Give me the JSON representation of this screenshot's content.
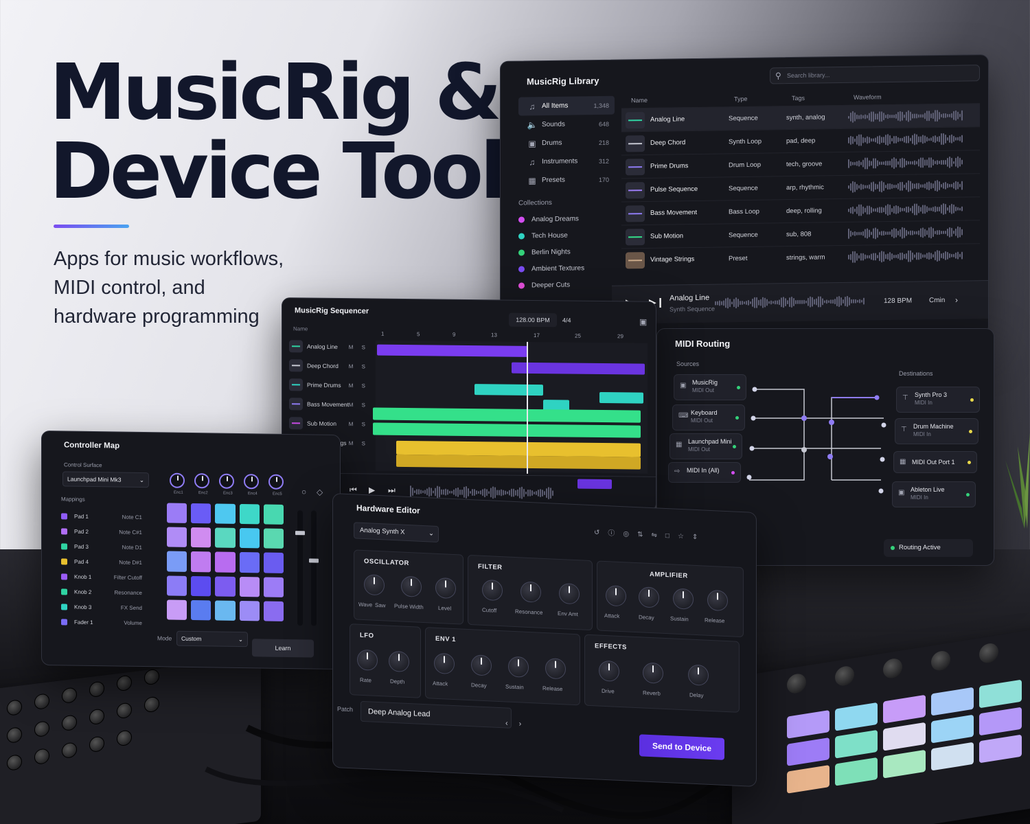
{
  "hero": {
    "title_line1": "MusicRig &",
    "title_line2": "Device Tools",
    "subtitle_line1": "Apps for music workflows,",
    "subtitle_line2": "MIDI control, and",
    "subtitle_line3": "hardware programming",
    "accent_gradient": [
      "#7a4cf0",
      "#4aa3f0"
    ]
  },
  "library": {
    "title": "MusicRig Library",
    "search_placeholder": "Search library...",
    "categories": [
      {
        "label": "All Items",
        "count": "1,348",
        "icon": "music-note-icon"
      },
      {
        "label": "Sounds",
        "count": "648",
        "icon": "speaker-icon"
      },
      {
        "label": "Drums",
        "count": "218",
        "icon": "drum-icon"
      },
      {
        "label": "Instruments",
        "count": "312",
        "icon": "music-note-icon"
      },
      {
        "label": "Presets",
        "count": "170",
        "icon": "preset-icon"
      }
    ],
    "collections_heading": "Collections",
    "collections": [
      {
        "label": "Analog Dreams",
        "color": "#d24ef0"
      },
      {
        "label": "Tech House",
        "color": "#2fd3c2"
      },
      {
        "label": "Berlin Nights",
        "color": "#34d17a"
      },
      {
        "label": "Ambient Textures",
        "color": "#7a4cf0"
      },
      {
        "label": "Deeper Cuts",
        "color": "#e04ed8"
      }
    ],
    "columns": [
      "Name",
      "Type",
      "Tags",
      "Waveform"
    ],
    "rows": [
      {
        "name": "Analog Line",
        "type": "Sequence",
        "tags": "synth, analog"
      },
      {
        "name": "Deep Chord",
        "type": "Synth Loop",
        "tags": "pad, deep"
      },
      {
        "name": "Prime Drums",
        "type": "Drum Loop",
        "tags": "tech, groove"
      },
      {
        "name": "Pulse Sequence",
        "type": "Sequence",
        "tags": "arp, rhythmic"
      },
      {
        "name": "Bass Movement",
        "type": "Bass Loop",
        "tags": "deep, rolling"
      },
      {
        "name": "Sub Motion",
        "type": "Sequence",
        "tags": "sub, 808"
      },
      {
        "name": "Vintage Strings",
        "type": "Preset",
        "tags": "strings, warm"
      }
    ],
    "player": {
      "track": "Analog Line",
      "subtitle": "Synth Sequence",
      "bpm": "128 BPM",
      "key": "Cmin"
    }
  },
  "routing": {
    "title": "MIDI Routing",
    "sources_heading": "Sources",
    "destinations_heading": "Destinations",
    "sources": [
      {
        "name": "MusicRig",
        "sub": "MIDI Out",
        "dot": "#34d17a"
      },
      {
        "name": "Keyboard",
        "sub": "MIDI Out",
        "dot": "#34d17a"
      },
      {
        "name": "Launchpad Mini",
        "sub": "MIDI Out",
        "dot": "#34d17a"
      },
      {
        "name": "MIDI In (All)",
        "sub": "",
        "dot": "#d24ef0"
      }
    ],
    "destinations": [
      {
        "name": "Synth Pro 3",
        "sub": "MIDI In",
        "dot": "#e8d84a"
      },
      {
        "name": "Drum Machine",
        "sub": "MIDI In",
        "dot": "#e8d84a"
      },
      {
        "name": "MIDI Out Port 1",
        "sub": "",
        "dot": "#e8d84a"
      },
      {
        "name": "Ableton Live",
        "sub": "MIDI In",
        "dot": "#34d17a"
      }
    ],
    "status": "Routing Active"
  },
  "sequencer": {
    "title": "MusicRig Sequencer",
    "bpm": "128.00 BPM",
    "signature": "4/4",
    "tracks_heading": "Name",
    "tracks": [
      {
        "name": "Analog Line",
        "ms": "M S"
      },
      {
        "name": "Deep Chord",
        "ms": "M S"
      },
      {
        "name": "Prime Drums",
        "ms": "M S"
      },
      {
        "name": "Bass Movement",
        "ms": "M S"
      },
      {
        "name": "Sub Motion",
        "ms": "M S"
      },
      {
        "name": "Vintage Strings",
        "ms": "M S"
      }
    ],
    "bars": [
      "1",
      "5",
      "9",
      "13",
      "17",
      "25",
      "29"
    ],
    "colors": {
      "purple": "#7a3cf0",
      "teal": "#2fd3c2",
      "green": "#34e08a",
      "yellow": "#e8c02e"
    }
  },
  "controller": {
    "title": "Controller Map",
    "surface_label": "Control Surface",
    "surface_value": "Launchpad Mini Mk3",
    "mappings_label": "Mappings",
    "mappings": [
      {
        "control": "Pad 1",
        "target": "Note C1",
        "color": "#8f5cf6"
      },
      {
        "control": "Pad 2",
        "target": "Note C#1",
        "color": "#b06ef5"
      },
      {
        "control": "Pad 3",
        "target": "Note D1",
        "color": "#2fd3a2"
      },
      {
        "control": "Pad 4",
        "target": "Note D#1",
        "color": "#e8c02e"
      },
      {
        "control": "Knob 1",
        "target": "Filter Cutoff",
        "color": "#9b5cf6"
      },
      {
        "control": "Knob 2",
        "target": "Resonance",
        "color": "#2fd3a2"
      },
      {
        "control": "Knob 3",
        "target": "FX Send",
        "color": "#2fd3c2"
      },
      {
        "control": "Fader 1",
        "target": "Volume",
        "color": "#7a6cf6"
      }
    ],
    "knob_labels": [
      "Enc1",
      "Enc2",
      "Enc3",
      "Enc4",
      "Enc5"
    ],
    "mode_label": "Mode",
    "mode_value": "Custom",
    "learn_label": "Learn"
  },
  "hardware": {
    "title": "Hardware Editor",
    "device": "Analog Synth X",
    "sections": {
      "oscillator": {
        "title": "OSCILLATOR",
        "knobs": [
          "Wave",
          "Saw",
          "Pulse Width",
          "Level"
        ]
      },
      "filter": {
        "title": "FILTER",
        "knobs": [
          "Cutoff",
          "Resonance",
          "Env Amt"
        ]
      },
      "amplifier": {
        "title": "AMPLIFIER",
        "knobs": [
          "Attack",
          "Decay",
          "Sustain",
          "Release"
        ]
      },
      "lfo": {
        "title": "LFO",
        "knobs": [
          "Rate",
          "Depth"
        ]
      },
      "env1": {
        "title": "ENV 1",
        "knobs": [
          "Attack",
          "Decay",
          "Sustain",
          "Release"
        ]
      },
      "effects": {
        "title": "EFFECTS",
        "knobs": [
          "Drive",
          "Reverb",
          "Delay"
        ]
      }
    },
    "patch_label": "Patch",
    "patch_value": "Deep Analog Lead",
    "send_label": "Send to Device"
  }
}
